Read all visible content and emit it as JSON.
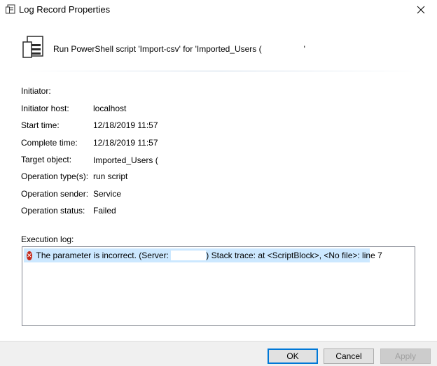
{
  "window": {
    "title": "Log Record Properties",
    "close_icon": "close-icon"
  },
  "header": {
    "icon": "log-record-icon",
    "text": "Run PowerShell script 'Import-csv' for 'Imported_Users ("
  },
  "properties": [
    {
      "label": "Initiator:",
      "value": ""
    },
    {
      "label": "Initiator host:",
      "value": "localhost"
    },
    {
      "label": "Start time:",
      "value": "12/18/2019 11:57"
    },
    {
      "label": "Complete time:",
      "value": "12/18/2019 11:57"
    },
    {
      "label": "Target object:",
      "value": "Imported_Users ("
    },
    {
      "label": "Operation type(s):",
      "value": "run script"
    },
    {
      "label": "Operation sender:",
      "value": "Service"
    },
    {
      "label": "Operation status:",
      "value": "Failed"
    }
  ],
  "execution_log": {
    "label": "Execution log:",
    "entries": [
      {
        "icon": "error-icon",
        "text_before": "The parameter is incorrect. (Server:",
        "text_after": ") Stack trace: at <ScriptBlock>, <No file>: line 7"
      }
    ]
  },
  "buttons": {
    "ok": "OK",
    "cancel": "Cancel",
    "apply": "Apply"
  },
  "colors": {
    "selection": "#cce8ff",
    "error": "#c42b1c",
    "footer": "#f0f0f0",
    "default_button_border": "#0078d7"
  }
}
